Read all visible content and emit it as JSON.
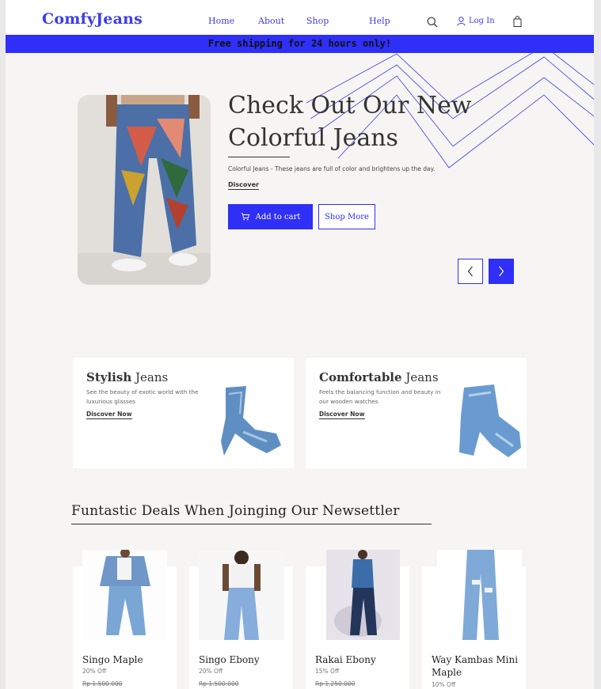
{
  "header": {
    "logo": "ComfyJeans",
    "nav": [
      "Home",
      "About",
      "Shop",
      "Help"
    ],
    "login_label": "Log In",
    "accent_color": "#3b3ee6"
  },
  "banner": {
    "text": "Free shipping for 24 hours only!",
    "color": "#2f2ff7"
  },
  "hero": {
    "title_line1": "Check Out Our New",
    "title_line2": "Colorful Jeans",
    "description": "Colorful Jeans - These jeans are full of color and brightens up the day.",
    "discover": "Discover",
    "add_to_cart": "Add to cart",
    "shop_more": "Shop More"
  },
  "features": [
    {
      "title_bold": "Stylish",
      "title_rest": "Jeans",
      "description": "See the beauty of exotic world with the luxurious glasses",
      "link": "Discover Now"
    },
    {
      "title_bold": "Comfortable",
      "title_rest": "Jeans",
      "description": "Feels the balancing function and beauty in our wooden watches",
      "link": "Discover Now"
    }
  ],
  "deals": {
    "heading": "Funtastic Deals When Joinging Our Newsettler",
    "products": [
      {
        "name": "Singo Maple",
        "discount": "20% Off",
        "price": "Rp 1.500.000"
      },
      {
        "name": "Singo Ebony",
        "discount": "20% Off",
        "price": "Rp 1.500.000"
      },
      {
        "name": "Rakai Ebony",
        "discount": "15% Off",
        "price": "Rp 1.250.000"
      },
      {
        "name": "Way Kambas Mini Maple",
        "discount": "10% Off",
        "price": ""
      }
    ]
  }
}
